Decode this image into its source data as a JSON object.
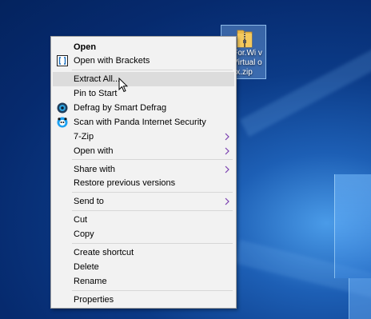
{
  "desktop": {
    "icon_label": "P.For.Wi vs.Virtual ox.zip"
  },
  "context_menu": {
    "open": "Open",
    "open_with_brackets": "Open with Brackets",
    "extract_all": "Extract All...",
    "pin_to_start": "Pin to Start",
    "defrag": "Defrag by Smart Defrag",
    "scan": "Scan with Panda Internet Security",
    "seven_zip": "7-Zip",
    "open_with": "Open with",
    "share_with": "Share with",
    "restore": "Restore previous versions",
    "send_to": "Send to",
    "cut": "Cut",
    "copy": "Copy",
    "create_shortcut": "Create shortcut",
    "delete": "Delete",
    "rename": "Rename",
    "properties": "Properties"
  },
  "colors": {
    "menu_bg": "#f2f2f2",
    "highlight": "#dcdcdc",
    "submenu_arrow": "#7a3fb0"
  }
}
